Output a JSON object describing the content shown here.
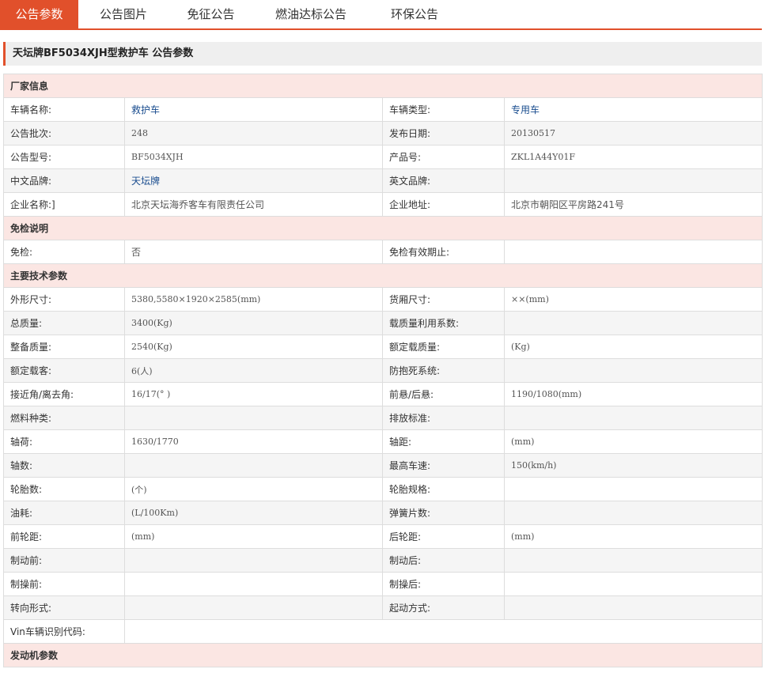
{
  "tabs": [
    {
      "label": "公告参数",
      "active": true
    },
    {
      "label": "公告图片",
      "active": false
    },
    {
      "label": "免征公告",
      "active": false
    },
    {
      "label": "燃油达标公告",
      "active": false
    },
    {
      "label": "环保公告",
      "active": false
    }
  ],
  "title": "天坛牌BF5034XJH型救护车 公告参数",
  "sections": {
    "manufacturer": "厂家信息",
    "exemption": "免检说明",
    "tech": "主要技术参数",
    "engine": "发动机参数"
  },
  "manufacturer": {
    "vehicle_name_label": "车辆名称:",
    "vehicle_name": "救护车",
    "vehicle_type_label": "车辆类型:",
    "vehicle_type": "专用车",
    "batch_label": "公告批次:",
    "batch": "248",
    "release_date_label": "发布日期:",
    "release_date": "20130517",
    "model_label": "公告型号:",
    "model": "BF5034XJH",
    "product_no_label": "产品号:",
    "product_no": "ZKL1A44Y01F",
    "cn_brand_label": "中文品牌:",
    "cn_brand": "天坛牌",
    "en_brand_label": "英文品牌:",
    "en_brand": "",
    "company_label": "企业名称:]",
    "company": "北京天坛海乔客车有限责任公司",
    "address_label": "企业地址:",
    "address": "北京市朝阳区平房路241号"
  },
  "exemption": {
    "exempt_label": "免检:",
    "exempt": "否",
    "valid_until_label": "免检有效期止:",
    "valid_until": ""
  },
  "tech": [
    {
      "l1": "外形尺寸:",
      "v1": "5380,5580×1920×2585(mm)",
      "l2": "货厢尺寸:",
      "v2": "××(mm)"
    },
    {
      "l1": "总质量:",
      "v1": "3400(Kg)",
      "l2": "载质量利用系数:",
      "v2": ""
    },
    {
      "l1": "整备质量:",
      "v1": "2540(Kg)",
      "l2": "额定载质量:",
      "v2": "(Kg)"
    },
    {
      "l1": "额定载客:",
      "v1": "6(人)",
      "l2": "防抱死系统:",
      "v2": ""
    },
    {
      "l1": "接近角/离去角:",
      "v1": "16/17(° )",
      "l2": "前悬/后悬:",
      "v2": "1190/1080(mm)"
    },
    {
      "l1": "燃料种类:",
      "v1": "",
      "l2": "排放标准:",
      "v2": ""
    },
    {
      "l1": "轴荷:",
      "v1": "1630/1770",
      "l2": "轴距:",
      "v2": "(mm)"
    },
    {
      "l1": "轴数:",
      "v1": "",
      "l2": "最高车速:",
      "v2": "150(km/h)"
    },
    {
      "l1": "轮胎数:",
      "v1": "(个)",
      "l2": "轮胎规格:",
      "v2": ""
    },
    {
      "l1": "油耗:",
      "v1": "(L/100Km)",
      "l2": "弹簧片数:",
      "v2": ""
    },
    {
      "l1": "前轮距:",
      "v1": "(mm)",
      "l2": "后轮距:",
      "v2": "(mm)"
    },
    {
      "l1": "制动前:",
      "v1": "",
      "l2": "制动后:",
      "v2": ""
    },
    {
      "l1": "制操前:",
      "v1": "",
      "l2": "制操后:",
      "v2": ""
    },
    {
      "l1": "转向形式:",
      "v1": "",
      "l2": "起动方式:",
      "v2": ""
    }
  ],
  "vin_label": "Vin车辆识别代码:",
  "vin": ""
}
